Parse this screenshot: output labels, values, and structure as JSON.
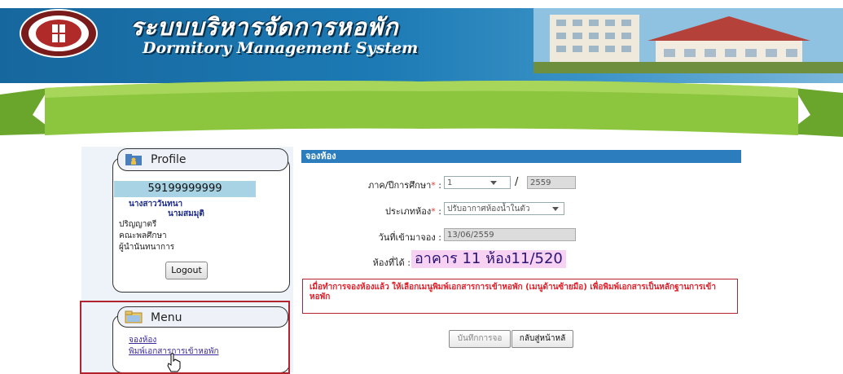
{
  "header": {
    "title_th": "ระบบบริหารจัดการหอพัก",
    "title_en": "Dormitory Management System"
  },
  "profile": {
    "heading": "Profile",
    "student_id": "59199999999",
    "name_line1": "นางสาววันทนา",
    "name_line2": "นามสมมุติ",
    "degree": "ปริญญาตรี",
    "faculty": "คณะพลศึกษา",
    "program": "ผู้นำนันทนาการ",
    "logout_label": "Logout"
  },
  "menu": {
    "heading": "Menu",
    "items": [
      {
        "label": "จองห้อง"
      },
      {
        "label": "พิมพ์เอกสารการเข้าหอพัก"
      }
    ]
  },
  "form": {
    "section_title": "จองห้อง",
    "term_label": "ภาค/ปีการศึกษา",
    "term_value": "1",
    "year_separator": "/",
    "year_value": "2559",
    "room_type_label": "ประเภทห้อง",
    "room_type_value": "ปรับอากาศห้องน้ำในตัว",
    "date_label": "วันที่เข้ามาจอง :",
    "date_value": "13/06/2559",
    "room_label": "ห้องที่ได้ :",
    "room_value": "อาคาร 11 ห้อง11/520",
    "colon": ":",
    "required_mark": "*",
    "notice": "เมื่อทำการจองห้องแล้ว ให้เลือกเมนูพิมพ์เอกสารการเข้าหอพัก (เมนูด้านซ้ายมือ) เพื่อพิมพ์เอกสารเป็นหลักฐานการเข้าหอพัก",
    "save_label": "บันทึกการจอ",
    "back_label": "กลับสู่หน้าหลั"
  },
  "colors": {
    "header_blue": "#1d7ab4",
    "ribbon_green": "#8cc63f",
    "form_bar": "#2c7dbd",
    "notice_red": "#e0202a",
    "frame_red": "#b3232f"
  }
}
